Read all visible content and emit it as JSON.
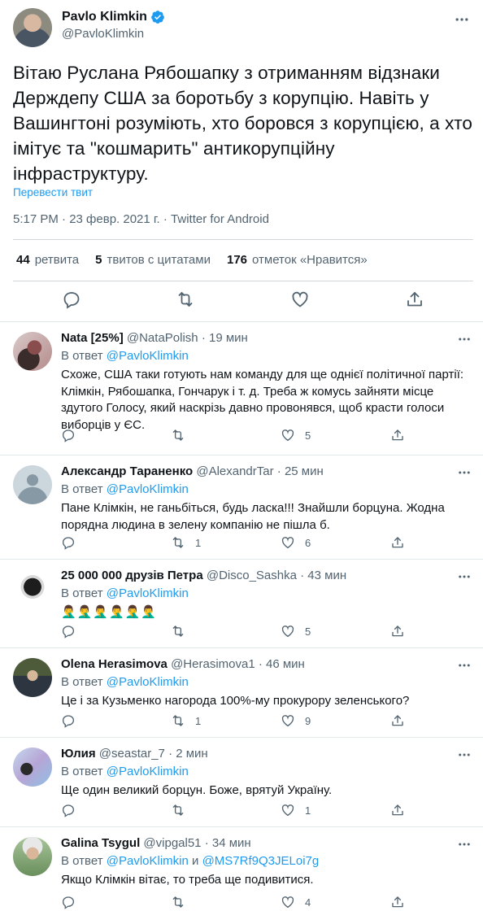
{
  "tweet": {
    "author_name": "Pavlo Klimkin",
    "author_handle": "@PavloKlimkin",
    "text": "Вітаю Руслана Рябошапку з отриманням відзнаки Держдепу США за боротьбу з корупцію. Навіть у Вашингтоні розуміють, хто боровся з корупцією, а хто імітує та \"кошмарить\" антикорупційну інфраструктуру.",
    "translate_label": "Перевести твит",
    "meta": "5:17 PM · 23 февр. 2021 г. · Twitter for Android",
    "stats": {
      "retweets_count": "44",
      "retweets_label": "ретвита",
      "quotes_count": "5",
      "quotes_label": "твитов с цитатами",
      "likes_count": "176",
      "likes_label": "отметок «Нравится»"
    }
  },
  "colors": {
    "accent": "#1d9bf0",
    "secondary_text": "#536471",
    "divider": "#cfd9de"
  },
  "replies": [
    {
      "name": "Nata [25%]",
      "handle": "@NataPolish",
      "time": "· 19 мин",
      "reply_prefix": "В ответ",
      "reply_to": "@PavloKlimkin",
      "text": "Схоже, США таки готують нам команду для ще однієї політичної партії: Клімкін, Рябошапка, Гончарук і т. д. Треба ж комусь зайняти місце здутого Голосу, який наскрізь давно провонявся, щоб красти голоси виборців у ЄС.",
      "replies_count": "",
      "retweets_count": "",
      "likes_count": "5"
    },
    {
      "name": "Александр Тараненко",
      "handle": "@AlexandrTar",
      "time": "· 25 мин",
      "reply_prefix": "В ответ",
      "reply_to": "@PavloKlimkin",
      "text": "Пане Клімкін, не ганьбіться, будь ласка!!! Знайшли борцуна. Жодна порядна людина в зелену компанію не пішла б.",
      "replies_count": "",
      "retweets_count": "1",
      "likes_count": "6"
    },
    {
      "name": "25 000 000 друзів Петра",
      "handle": "@Disco_Sashka",
      "time": "· 43 мин",
      "reply_prefix": "В ответ",
      "reply_to": "@PavloKlimkin",
      "text": "🤦‍♂️🤦‍♂️🤦‍♂️🤦‍♂️🤦‍♂️🤦‍♂️",
      "replies_count": "",
      "retweets_count": "",
      "likes_count": "5"
    },
    {
      "name": "Olena Herasimova",
      "handle": "@Herasimova1",
      "time": "· 46 мин",
      "reply_prefix": "В ответ",
      "reply_to": "@PavloKlimkin",
      "text": "Це і за Кузьменко нагорода 100%-му прокурору зеленського?",
      "replies_count": "",
      "retweets_count": "1",
      "likes_count": "9"
    },
    {
      "name": "Юлия",
      "handle": "@seastar_7",
      "time": "· 2 мин",
      "reply_prefix": "В ответ",
      "reply_to": "@PavloKlimkin",
      "text": "Ще один великий борцун. Боже, врятуй Україну.",
      "replies_count": "",
      "retweets_count": "",
      "likes_count": "1"
    },
    {
      "name": "Galina Tsygul",
      "handle": "@vipgal51",
      "time": "· 34 мин",
      "reply_prefix": "В ответ",
      "reply_to": "@PavloKlimkin",
      "reply_and": "и",
      "reply_to_2": "@MS7Rf9Q3JELoi7g",
      "text": "Якщо Клімкін вітає, то треба ще подивитися.",
      "replies_count": "",
      "retweets_count": "",
      "likes_count": "4"
    }
  ]
}
